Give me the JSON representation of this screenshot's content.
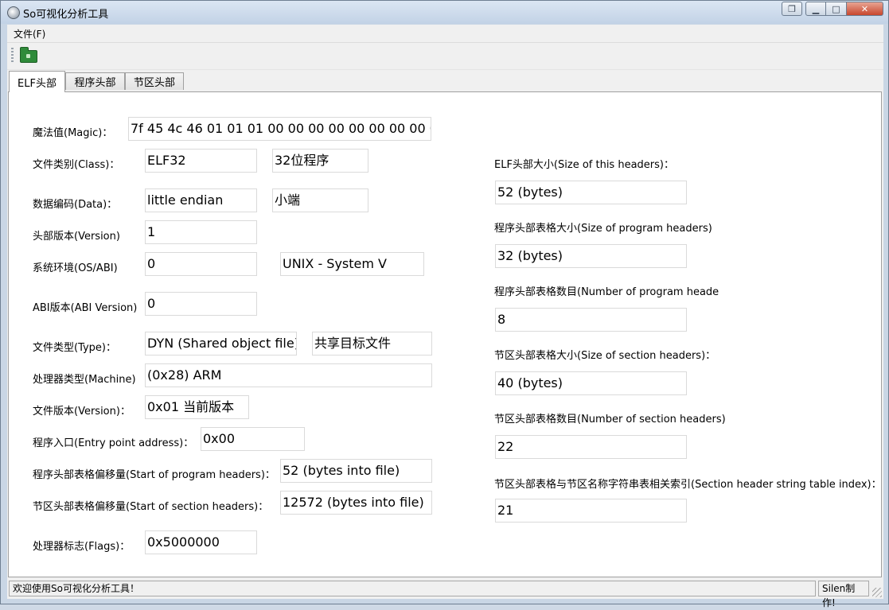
{
  "window": {
    "title": "So可视化分析工具"
  },
  "menu": {
    "file": "文件(F)"
  },
  "tabs": [
    "ELF头部",
    "程序头部",
    "节区头部"
  ],
  "left": {
    "magic": {
      "label": "魔法值(Magic)：",
      "value": "7f 45 4c 46 01 01 01 00 00 00 00 00 00 00 00 00"
    },
    "class": {
      "label": "文件类别(Class)：",
      "value": "ELF32",
      "desc": "32位程序"
    },
    "data": {
      "label": "数据编码(Data)：",
      "value": "little endian",
      "desc": "小端"
    },
    "version": {
      "label": "头部版本(Version)",
      "value": "1"
    },
    "osabi": {
      "label": "系统环境(OS/ABI)",
      "value": "0",
      "desc": "UNIX - System V"
    },
    "abiversion": {
      "label": "ABI版本(ABI Version)",
      "value": "0"
    },
    "type": {
      "label": "文件类型(Type)：",
      "value": "DYN (Shared object file)",
      "desc": "共享目标文件"
    },
    "machine": {
      "label": "处理器类型(Machine)",
      "value": "(0x28) ARM"
    },
    "fileversion": {
      "label": "文件版本(Version)：",
      "value": "0x01 当前版本"
    },
    "entry": {
      "label": "程序入口(Entry point address)：",
      "value": "0x00"
    },
    "phoff": {
      "label": "程序头部表格偏移量(Start of program headers)：",
      "value": "52 (bytes into file)"
    },
    "shoff": {
      "label": "节区头部表格偏移量(Start of section headers)：",
      "value": "12572 (bytes into file)"
    },
    "flags": {
      "label": "处理器标志(Flags)：",
      "value": "0x5000000"
    }
  },
  "right": {
    "ehsize": {
      "label": "ELF头部大小(Size of this headers)：",
      "value": "52 (bytes)"
    },
    "phentsize": {
      "label": "程序头部表格大小(Size of program headers)",
      "value": "32 (bytes)"
    },
    "phnum": {
      "label": "程序头部表格数目(Number of program heade",
      "value": "8"
    },
    "shentsize": {
      "label": "节区头部表格大小(Size of section headers)：",
      "value": "40 (bytes)"
    },
    "shnum": {
      "label": "节区头部表格数目(Number of section headers)",
      "value": "22"
    },
    "shstrndx": {
      "label": "节区头部表格与节区名称字符串表相关索引(Section header string table index)：",
      "value": "21"
    }
  },
  "status": {
    "message": "欢迎使用So可视化分析工具！",
    "author": "Silen制作!"
  }
}
